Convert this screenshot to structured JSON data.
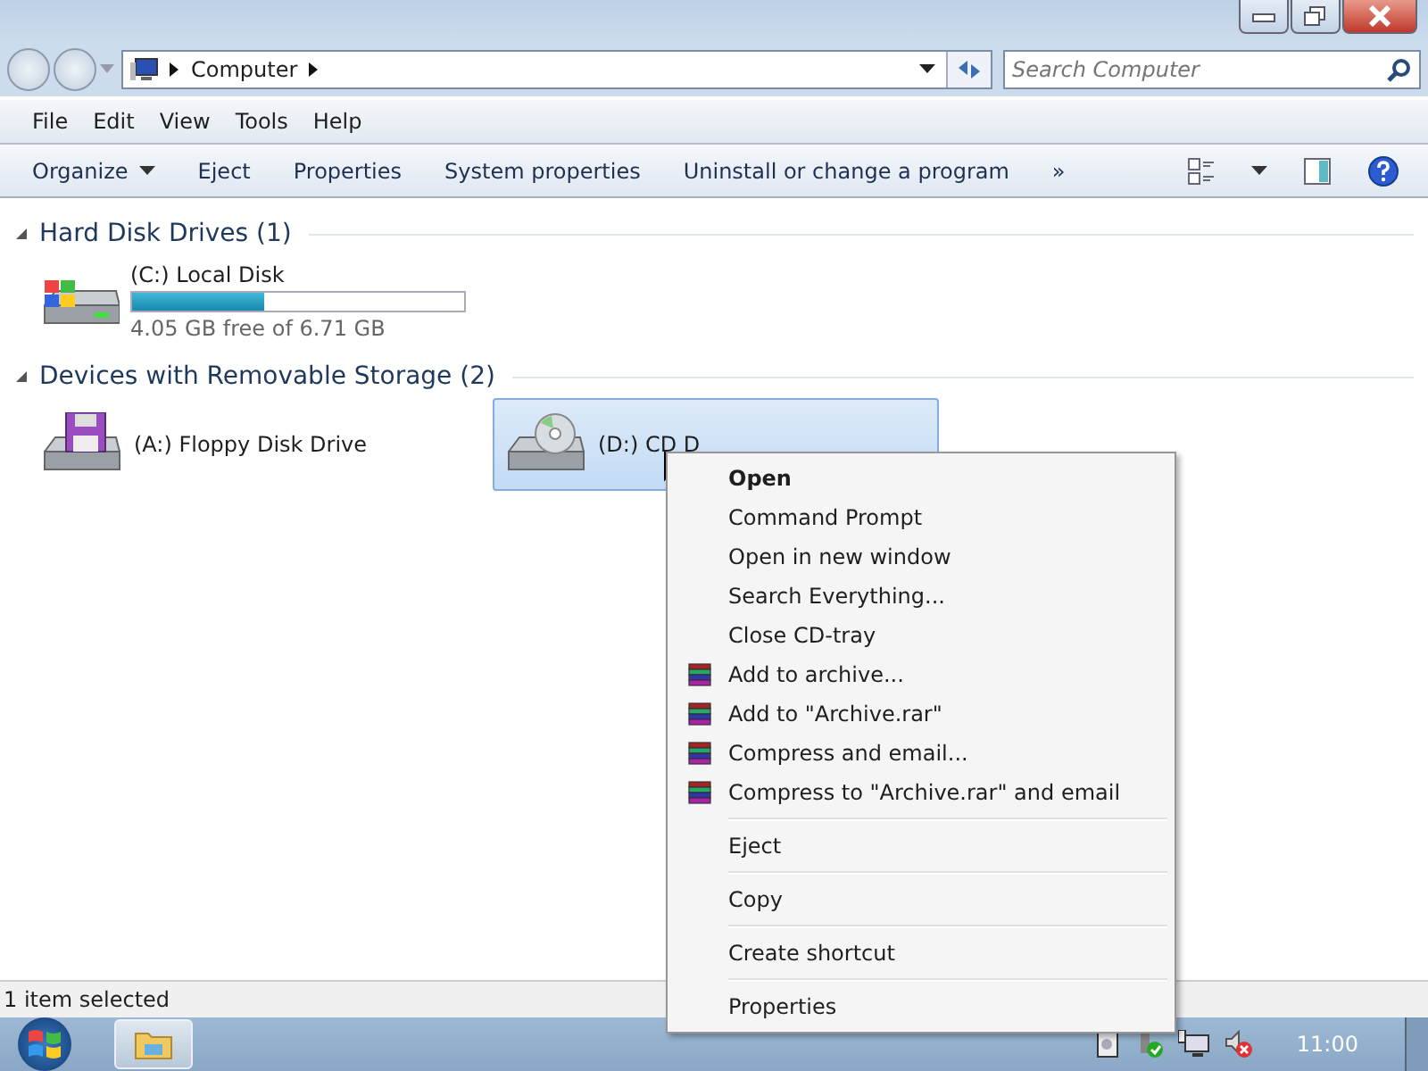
{
  "address_bar": {
    "crumbs": [
      "Computer"
    ]
  },
  "search": {
    "placeholder": "Search Computer"
  },
  "menu_bar": [
    "File",
    "Edit",
    "View",
    "Tools",
    "Help"
  ],
  "command_bar": [
    "Organize",
    "Eject",
    "Properties",
    "System properties",
    "Uninstall or change a program",
    "»"
  ],
  "groups": [
    {
      "title": "Hard Disk Drives (1)",
      "expanded": true,
      "drives": [
        {
          "kind": "hdd",
          "name": "(C:) Local Disk",
          "level": 0.4,
          "detail": "4.05 GB free of 6.71 GB",
          "selected": false
        }
      ]
    },
    {
      "title": "Devices with Removable Storage (2)",
      "expanded": true,
      "drives": [
        {
          "kind": "floppy",
          "name": "(A:) Floppy Disk Drive",
          "selected": false
        },
        {
          "kind": "cd",
          "name": "(D:) CD D",
          "selected": true
        }
      ]
    }
  ],
  "context_menu": [
    [
      {
        "label": "Open",
        "kind": "default"
      },
      {
        "label": "Command Prompt",
        "kind": "plain"
      },
      {
        "label": "Open in new window",
        "kind": "plain"
      },
      {
        "label": "Search Everything...",
        "kind": "plain"
      },
      {
        "label": "Close CD-tray",
        "kind": "plain"
      },
      {
        "label": "Add to archive...",
        "kind": "archive"
      },
      {
        "label": "Add to \"Archive.rar\"",
        "kind": "archive"
      },
      {
        "label": "Compress and email...",
        "kind": "archive"
      },
      {
        "label": "Compress to \"Archive.rar\" and email",
        "kind": "archive"
      }
    ],
    [
      {
        "label": "Eject",
        "kind": "plain"
      }
    ],
    [
      {
        "label": "Copy",
        "kind": "plain"
      }
    ],
    [
      {
        "label": "Create shortcut",
        "kind": "plain"
      }
    ],
    [
      {
        "label": "Properties",
        "kind": "plain"
      }
    ]
  ],
  "status_bar": {
    "text": "1 item selected"
  },
  "taskbar": {
    "clock": "11:00"
  }
}
